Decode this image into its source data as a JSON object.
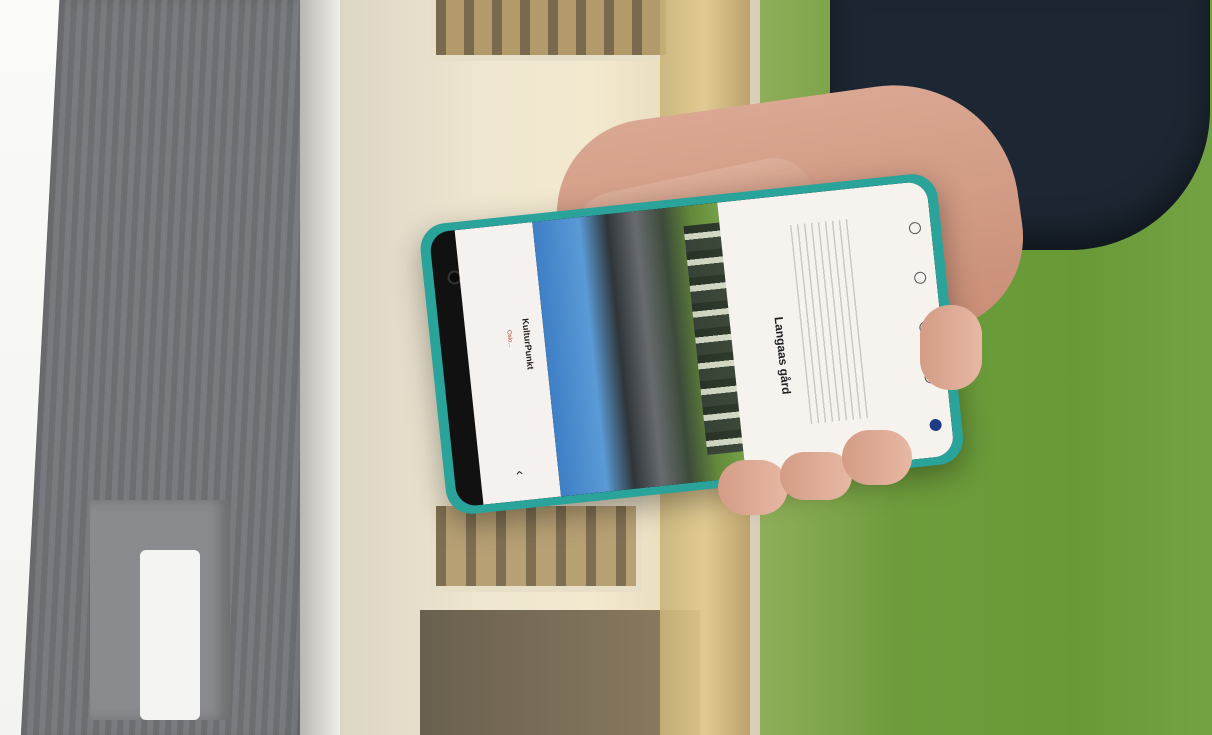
{
  "scene": {
    "subject": "hand-holding-smartphone",
    "background_colors": {
      "roof": "#6c6e72",
      "facade": "#efe6cf",
      "lawn": "#6c9c3f",
      "sleeve": "#1d2733",
      "phone_case": "#2aa39a"
    }
  },
  "app": {
    "left_panel": {
      "title": "KulturPunkt",
      "subtitle": "Oslo..."
    },
    "right_panel": {
      "title": "Langaas gård"
    },
    "accent_color": "#1f3d86",
    "icons": [
      "chevron-down-icon",
      "chevron-up-icon",
      "home-icon"
    ]
  }
}
